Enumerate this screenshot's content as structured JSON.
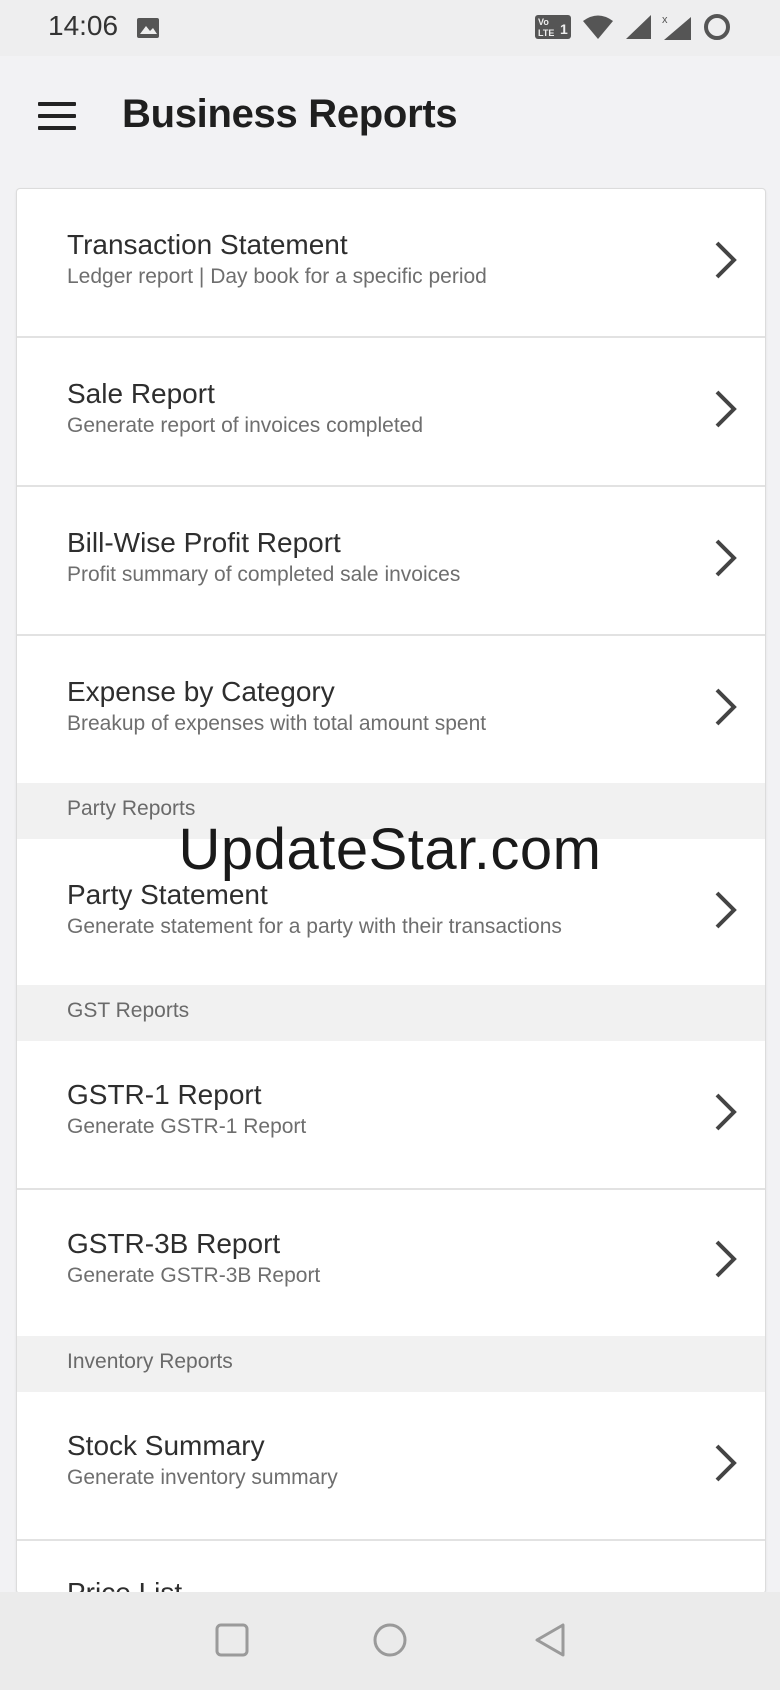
{
  "status_bar": {
    "time": "14:06",
    "icons": [
      "gallery-icon",
      "volte-icon",
      "wifi-icon",
      "signal-icon",
      "signal-x-icon",
      "battery-ring-icon"
    ],
    "lte_label": "VoLTE 1"
  },
  "app_bar": {
    "title": "Business Reports",
    "menu_icon": "hamburger-menu-icon"
  },
  "reports": [
    {
      "title": "Transaction Statement",
      "subtitle": "Ledger report | Day book for a specific period"
    },
    {
      "title": "Sale Report",
      "subtitle": "Generate report of invoices completed"
    },
    {
      "title": "Bill-Wise Profit Report",
      "subtitle": "Profit summary of completed sale invoices"
    },
    {
      "title": "Expense by Category",
      "subtitle": "Breakup of expenses with total amount spent"
    }
  ],
  "party_section": {
    "header": "Party Reports",
    "items": [
      {
        "title": "Party Statement",
        "subtitle": "Generate statement for a party with their transactions"
      }
    ]
  },
  "gst_section": {
    "header": "GST Reports",
    "items": [
      {
        "title": "GSTR-1 Report",
        "subtitle": "Generate GSTR-1 Report"
      },
      {
        "title": "GSTR-3B Report",
        "subtitle": "Generate GSTR-3B Report"
      }
    ]
  },
  "inventory_section": {
    "header": "Inventory Reports",
    "items": [
      {
        "title": "Stock Summary",
        "subtitle": "Generate inventory summary"
      },
      {
        "title": "Price List"
      }
    ]
  },
  "watermark": "UpdateStar.com",
  "nav_bar": {
    "icons": [
      "recent-apps-icon",
      "home-icon",
      "back-icon"
    ]
  },
  "colors": {
    "background": "#f2f2f4",
    "card": "#ffffff",
    "section_header": "#f1f1f1",
    "title_text": "#2e2e2e",
    "subtitle_text": "#6e6e6e"
  }
}
